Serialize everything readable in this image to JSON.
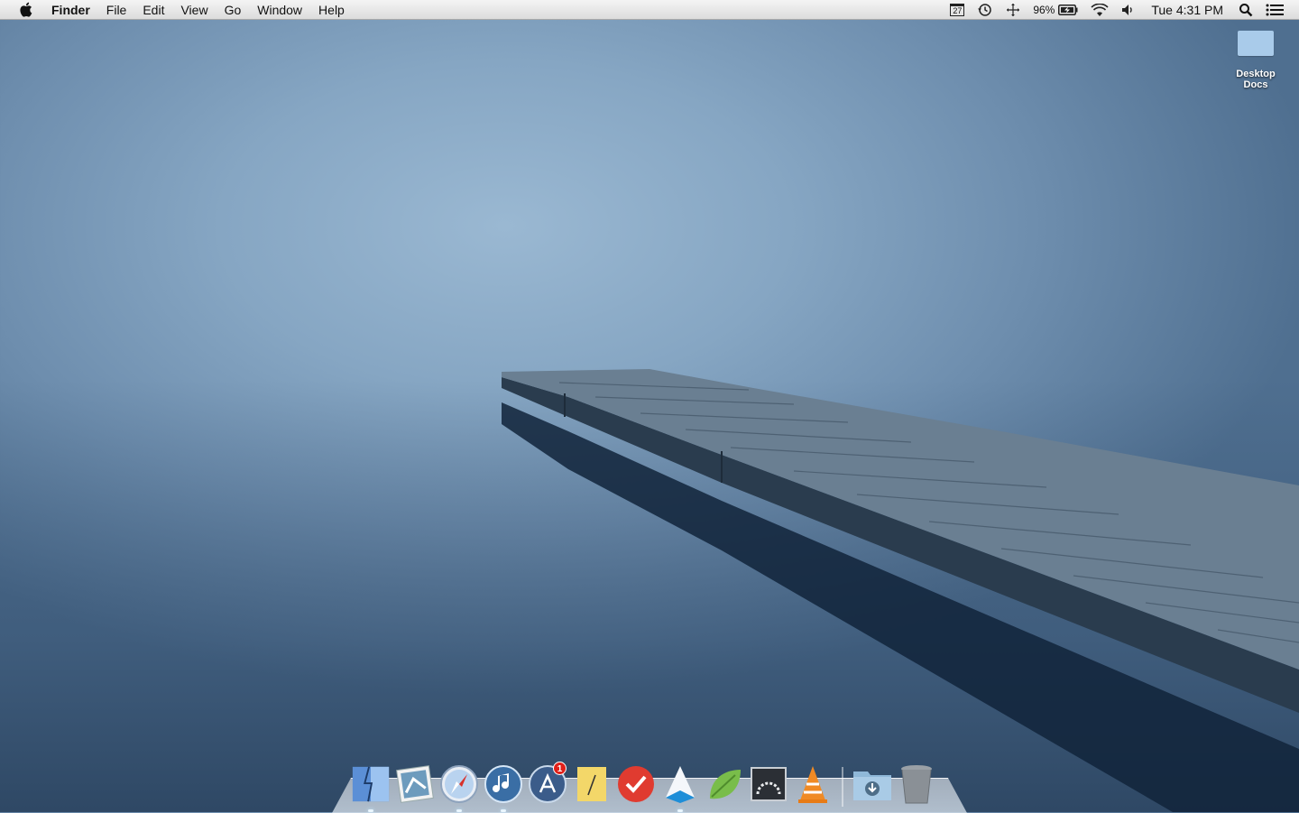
{
  "menubar": {
    "app_name": "Finder",
    "menus": [
      "File",
      "Edit",
      "View",
      "Go",
      "Window",
      "Help"
    ],
    "calendar_day": "27",
    "battery_percent": "96%",
    "clock": "Tue 4:31 PM"
  },
  "desktop": {
    "icon_label": "Desktop Docs"
  },
  "dock": {
    "items": [
      {
        "name": "finder",
        "badge": ""
      },
      {
        "name": "preview",
        "badge": ""
      },
      {
        "name": "safari",
        "badge": ""
      },
      {
        "name": "itunes",
        "badge": ""
      },
      {
        "name": "app-store",
        "badge": "1"
      },
      {
        "name": "notes",
        "badge": ""
      },
      {
        "name": "wunderlist",
        "badge": ""
      },
      {
        "name": "navigation",
        "badge": ""
      },
      {
        "name": "leaf",
        "badge": ""
      },
      {
        "name": "activity-monitor",
        "badge": ""
      },
      {
        "name": "vlc",
        "badge": ""
      },
      {
        "name": "downloads",
        "badge": ""
      },
      {
        "name": "trash",
        "badge": ""
      }
    ]
  },
  "colors": {
    "sky": "#9ab8d2",
    "water_dark": "#1d3650",
    "pier": "#5f7487",
    "badge": "#e0201a"
  }
}
